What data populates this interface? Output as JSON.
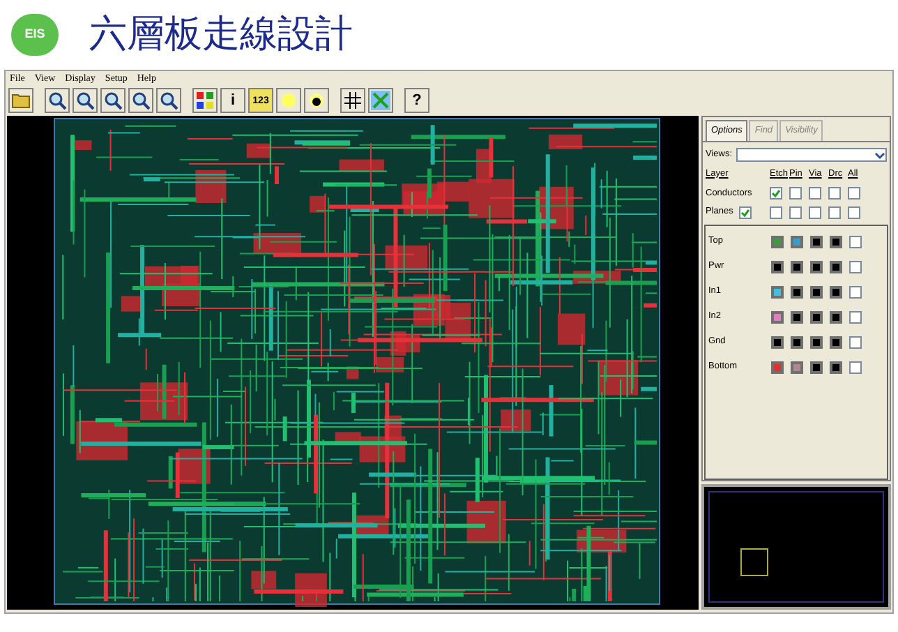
{
  "header": {
    "logo_text": "EIS",
    "title": "六層板走線設計"
  },
  "menu": [
    "File",
    "View",
    "Display",
    "Setup",
    "Help"
  ],
  "toolbar": [
    {
      "kind": "folder"
    },
    {
      "kind": "sep"
    },
    {
      "kind": "zoom"
    },
    {
      "kind": "zoom"
    },
    {
      "kind": "zoom"
    },
    {
      "kind": "zoom"
    },
    {
      "kind": "zoom"
    },
    {
      "kind": "sep"
    },
    {
      "kind": "colors"
    },
    {
      "kind": "text",
      "label": "i"
    },
    {
      "kind": "ruler",
      "label": "123"
    },
    {
      "kind": "light"
    },
    {
      "kind": "dot"
    },
    {
      "kind": "sep"
    },
    {
      "kind": "grid"
    },
    {
      "kind": "net"
    },
    {
      "kind": "sep"
    },
    {
      "kind": "text",
      "label": "?"
    }
  ],
  "panel": {
    "tabs": [
      {
        "label": "Options",
        "selected": true
      },
      {
        "label": "Find",
        "selected": false
      },
      {
        "label": "Visibility",
        "selected": false
      }
    ],
    "views_label": "Views:",
    "columns": [
      "Layer",
      "Etch",
      "Pin",
      "Via",
      "Drc",
      "All"
    ],
    "groups": [
      {
        "label": "Conductors",
        "boxes": [
          true,
          false,
          false,
          false,
          false
        ]
      },
      {
        "label": "Planes",
        "label_box": {
          "checked": true
        },
        "boxes": [
          false,
          false,
          false,
          false,
          false
        ]
      }
    ],
    "layers": [
      {
        "name": "Top",
        "swatches": [
          {
            "color": "#3c9c3c"
          },
          {
            "color": "#3a9cc8"
          },
          {
            "color": "#000000"
          },
          {
            "color": "#000000"
          }
        ],
        "all": false
      },
      {
        "name": "Pwr",
        "swatches": [
          {
            "color": "#000000"
          },
          {
            "color": "#000000"
          },
          {
            "color": "#000000"
          },
          {
            "color": "#000000"
          }
        ],
        "all": false
      },
      {
        "name": "In1",
        "swatches": [
          {
            "color": "#40c0e0"
          },
          {
            "color": "#000000"
          },
          {
            "color": "#000000"
          },
          {
            "color": "#000000"
          }
        ],
        "all": false
      },
      {
        "name": "In2",
        "swatches": [
          {
            "color": "#e080c0"
          },
          {
            "color": "#000000"
          },
          {
            "color": "#000000"
          },
          {
            "color": "#000000"
          }
        ],
        "all": false
      },
      {
        "name": "Gnd",
        "swatches": [
          {
            "color": "#000000"
          },
          {
            "color": "#000000"
          },
          {
            "color": "#000000"
          },
          {
            "color": "#000000"
          }
        ],
        "all": false
      },
      {
        "name": "Bottom",
        "swatches": [
          {
            "color": "#e03030"
          },
          {
            "color": "#b08890"
          },
          {
            "color": "#000000"
          },
          {
            "color": "#000000"
          }
        ],
        "all": false
      }
    ]
  }
}
